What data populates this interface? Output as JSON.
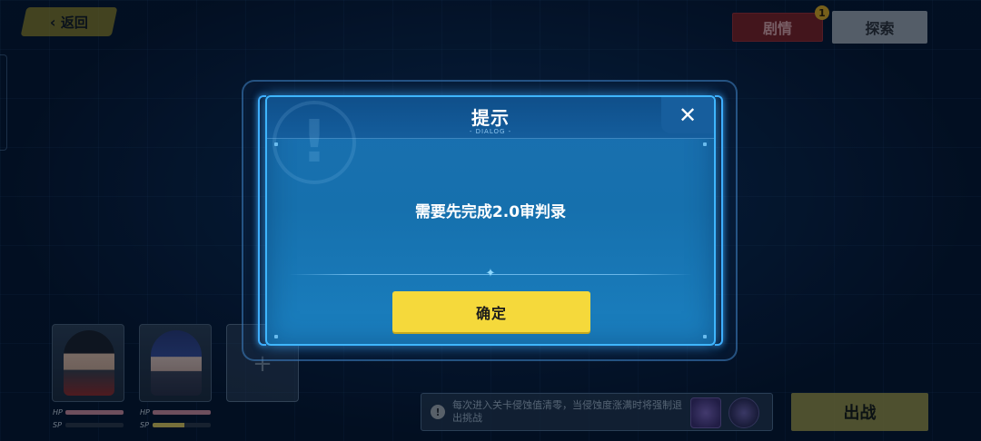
{
  "top_bar": {
    "back_label": "返回",
    "story_label": "剧情",
    "story_badge": "1",
    "explore_label": "探索"
  },
  "dialog": {
    "title": "提示",
    "subtitle": "- DIALOG -",
    "close_symbol": "✕",
    "message": "需要先完成2.0审判录",
    "confirm_label": "确定"
  },
  "team": {
    "hp_label": "HP",
    "sp_label": "SP",
    "members": [
      {
        "hp": 1.0,
        "sp": 0.0
      },
      {
        "hp": 1.0,
        "sp": 0.55
      }
    ],
    "empty_slot_symbol": "+"
  },
  "bottom": {
    "hint_icon": "!",
    "hint_text": "每次进入关卡侵蚀值清零，当侵蚀度涨满时将强制退出挑战",
    "deploy_label": "出战"
  },
  "icons": {
    "back": "chevron-left-icon",
    "close": "close-icon",
    "hint": "warning-icon"
  },
  "colors": {
    "confirm_button": "#f5d93b",
    "dialog_border": "#3fb6ff",
    "story_button": "#7a1f24"
  }
}
